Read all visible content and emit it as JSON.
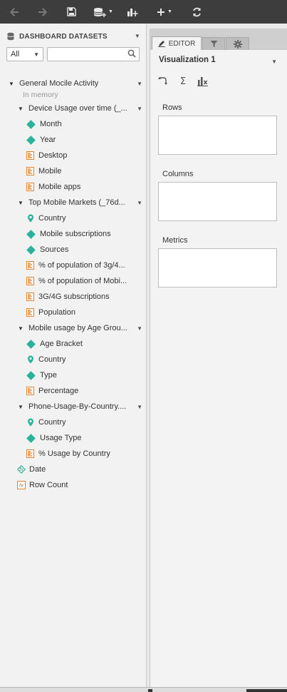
{
  "toolbar": {
    "buttons": [
      {
        "name": "undo",
        "icon": "arrow-left-icon",
        "glyph": "⬅",
        "enabled": false
      },
      {
        "name": "redo",
        "icon": "arrow-right-icon",
        "glyph": "➡",
        "enabled": false
      },
      {
        "name": "save",
        "icon": "save-icon",
        "glyph": "💾",
        "enabled": true
      },
      {
        "name": "add-data",
        "icon": "database-add-icon",
        "glyph": "≡",
        "enabled": true
      },
      {
        "name": "add-visualization",
        "icon": "chart-add-icon",
        "glyph": "▟",
        "enabled": true
      },
      {
        "name": "insert",
        "icon": "plus-icon",
        "glyph": "+",
        "enabled": true
      },
      {
        "name": "refresh",
        "icon": "refresh-icon",
        "glyph": "⟳",
        "enabled": true
      }
    ]
  },
  "datasets_panel": {
    "title": "DASHBOARD DATASETS",
    "filter": {
      "selected": "All"
    },
    "search": {
      "value": "",
      "placeholder": ""
    }
  },
  "tree": [
    {
      "type": "dataset",
      "label": "General Mocile Activity",
      "subtitle": "In memory"
    },
    {
      "type": "table",
      "label": "Device Usage over time (_...",
      "children": [
        {
          "kind": "attribute",
          "label": "Month"
        },
        {
          "kind": "attribute",
          "label": "Year"
        },
        {
          "kind": "metric",
          "label": "Desktop"
        },
        {
          "kind": "metric",
          "label": "Mobile"
        },
        {
          "kind": "metric",
          "label": "Mobile apps"
        }
      ]
    },
    {
      "type": "table",
      "label": "Top Mobile Markets (_76d...",
      "children": [
        {
          "kind": "geo",
          "label": "Country"
        },
        {
          "kind": "attribute",
          "label": "Mobile subscriptions"
        },
        {
          "kind": "attribute",
          "label": "Sources"
        },
        {
          "kind": "metric",
          "label": "% of population of 3g/4..."
        },
        {
          "kind": "metric",
          "label": "% of population of Mobi..."
        },
        {
          "kind": "metric",
          "label": "3G/4G subscriptions"
        },
        {
          "kind": "metric",
          "label": "Population"
        }
      ]
    },
    {
      "type": "table",
      "label": "Mobile usage by Age Grou...",
      "children": [
        {
          "kind": "attribute",
          "label": "Age Bracket"
        },
        {
          "kind": "geo",
          "label": "Country"
        },
        {
          "kind": "attribute",
          "label": "Type"
        },
        {
          "kind": "metric",
          "label": "Percentage"
        }
      ]
    },
    {
      "type": "table",
      "label": "Phone-Usage-By-Country....",
      "children": [
        {
          "kind": "geo",
          "label": "Country"
        },
        {
          "kind": "attribute",
          "label": "Usage Type"
        },
        {
          "kind": "metric",
          "label": "% Usage by Country"
        }
      ]
    },
    {
      "type": "derived-attribute",
      "label": "Date"
    },
    {
      "type": "derived-metric",
      "label": "Row Count"
    }
  ],
  "editor_panel": {
    "tabs": [
      {
        "label": "EDITOR",
        "icon": "pencil-icon",
        "active": true
      },
      {
        "label": "",
        "icon": "filter-icon",
        "active": false
      },
      {
        "label": "",
        "icon": "gear-icon",
        "active": false
      }
    ],
    "visualization_title": "Visualization 1",
    "tools": [
      {
        "icon": "swap-axes-icon",
        "glyph": "⤷"
      },
      {
        "icon": "sigma-icon",
        "glyph": "Σ"
      },
      {
        "icon": "chart-settings-icon",
        "glyph": "▟"
      }
    ],
    "shelves": [
      {
        "label": "Rows"
      },
      {
        "label": "Columns"
      },
      {
        "label": "Metrics"
      }
    ]
  },
  "colors": {
    "toolbar_bg": "#3d3d3d",
    "attribute_icon": "#2ab39a",
    "metric_icon": "#e8832a"
  }
}
